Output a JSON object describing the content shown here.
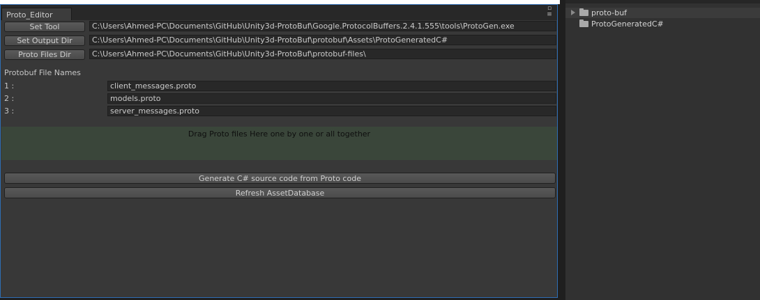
{
  "window": {
    "tab_label": "Proto_Editor"
  },
  "tool_rows": [
    {
      "button": "Set Tool",
      "path": "C:\\Users\\Ahmed-PC\\Documents\\GitHub\\Unity3d-ProtoBuf\\Google.ProtocolBuffers.2.4.1.555\\tools\\ProtoGen.exe"
    },
    {
      "button": "Set Output Dir",
      "path": "C:\\Users\\Ahmed-PC\\Documents\\GitHub\\Unity3d-ProtoBuf\\protobuf\\Assets\\ProtoGeneratedC#"
    },
    {
      "button": "Proto Files Dir",
      "path": "C:\\Users\\Ahmed-PC\\Documents\\GitHub\\Unity3d-ProtoBuf\\protobuf-files\\"
    }
  ],
  "section_title": "Protobuf File Names",
  "files": [
    {
      "index": "1 :",
      "name": "client_messages.proto"
    },
    {
      "index": "2 :",
      "name": "models.proto"
    },
    {
      "index": "3 :",
      "name": "server_messages.proto"
    }
  ],
  "dropzone_text": "Drag Proto files Here one by one or all together",
  "actions": {
    "generate": "Generate C# source code from Proto code",
    "refresh": "Refresh AssetDatabase"
  },
  "project_tree": [
    {
      "label": "proto-buf",
      "selected": true,
      "expandable": true
    },
    {
      "label": "ProtoGeneratedC#",
      "selected": false,
      "expandable": false
    }
  ]
}
